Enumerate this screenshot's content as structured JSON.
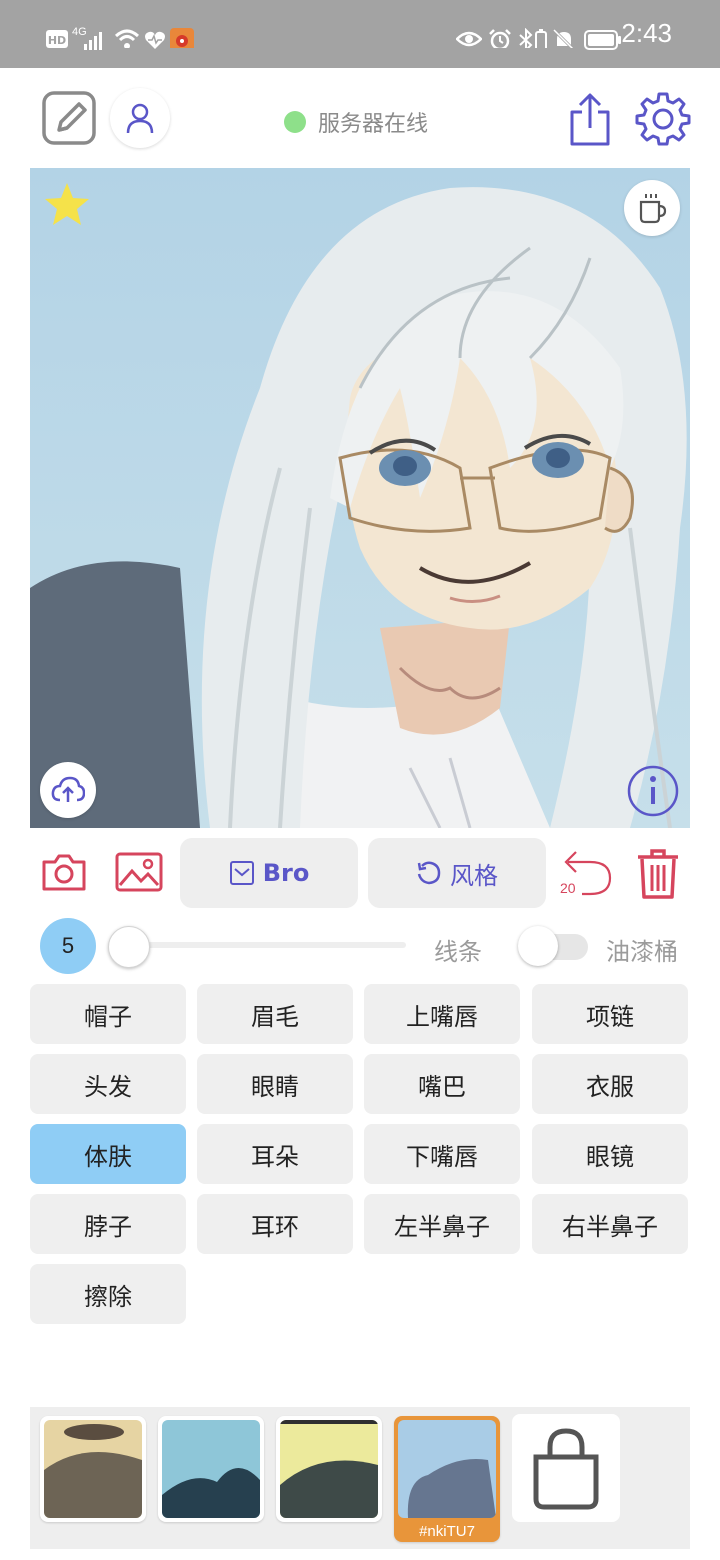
{
  "status_bar": {
    "time": "2:43",
    "network": "4G"
  },
  "header": {
    "server_status": "服务器在线"
  },
  "toolbar": {
    "bro_label": "Bro",
    "style_label": "风格",
    "undo_count": "20"
  },
  "brush": {
    "size": "5",
    "slider_level": 0,
    "line_label": "线条",
    "bucket_label": "油漆桶",
    "bucket_on": false
  },
  "parts": [
    {
      "label": "帽子",
      "selected": false
    },
    {
      "label": "眉毛",
      "selected": false
    },
    {
      "label": "上嘴唇",
      "selected": false
    },
    {
      "label": "项链",
      "selected": false
    },
    {
      "label": "头发",
      "selected": false
    },
    {
      "label": "眼睛",
      "selected": false
    },
    {
      "label": "嘴巴",
      "selected": false
    },
    {
      "label": "衣服",
      "selected": false
    },
    {
      "label": "体肤",
      "selected": true
    },
    {
      "label": "耳朵",
      "selected": false
    },
    {
      "label": "下嘴唇",
      "selected": false
    },
    {
      "label": "眼镜",
      "selected": false
    },
    {
      "label": "脖子",
      "selected": false
    },
    {
      "label": "耳环",
      "selected": false
    },
    {
      "label": "左半鼻子",
      "selected": false
    },
    {
      "label": "右半鼻子",
      "selected": false
    },
    {
      "label": "擦除",
      "selected": false
    }
  ],
  "gallery": {
    "selected_tag": "#nkiTU7"
  },
  "colors": {
    "accent": "#5a56c8",
    "danger": "#d6455d",
    "selected": "#8fcdf5",
    "server_online": "#8ee08a",
    "thumb_selected": "#e8953a"
  }
}
